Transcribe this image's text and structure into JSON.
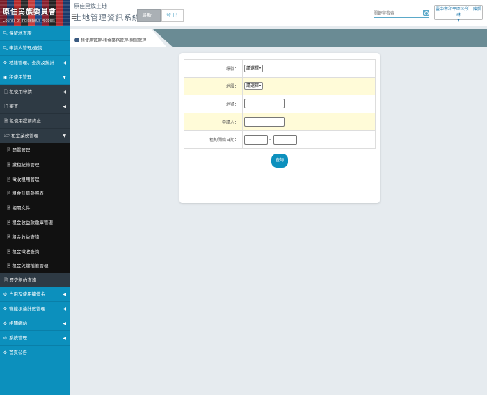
{
  "header": {
    "logo_text": "原住民族委員會",
    "logo_sub": "Council of Indigenous Peoples",
    "title_line1": "原住民族土地",
    "title_line2": "土地管理資訊系統",
    "notice_label": "最新公告",
    "logout_label": "登 出",
    "search_placeholder": "關鍵字檢索",
    "user_line1": "臺中市和平區公所：陳凱琳",
    "user_line2": "▾"
  },
  "sidebar": {
    "items": [
      {
        "label": "保留地查詢",
        "icon": "search-icon"
      },
      {
        "label": "申請人管理/查詢",
        "icon": "search-icon"
      },
      {
        "label": "地籍管理、查詢及統計",
        "icon": "gear-icon",
        "arrow": "◀"
      },
      {
        "label": "租使用管理",
        "icon": "globe-icon",
        "arrow": "▼"
      }
    ],
    "sub": [
      {
        "label": "租使用申請",
        "icon": "file-icon",
        "arrow": "◀"
      },
      {
        "label": "審查",
        "icon": "file-icon",
        "arrow": "◀"
      },
      {
        "label": "租使用提前終止",
        "icon": "doc-icon"
      },
      {
        "label": "租金業務管理",
        "icon": "folder-icon",
        "arrow": "▼"
      }
    ],
    "sub2": [
      "開單管理",
      "繳租紀錄管理",
      "徵收租用管理",
      "租金計算參照表",
      "相關文件",
      "租金收益款繳庫管理",
      "租金收益查詢",
      "租金徵收查詢",
      "租金欠繳稽催管理"
    ],
    "history": "歷史租約查詢",
    "bottom": [
      {
        "label": "占用及使用補償金",
        "icon": "gear-icon",
        "arrow": "◀"
      },
      {
        "label": "機能項補計數管理",
        "icon": "gear-icon",
        "arrow": "◀"
      },
      {
        "label": "相關網站",
        "icon": "gear-icon",
        "arrow": "◀"
      },
      {
        "label": "系統管理",
        "icon": "gear-icon",
        "arrow": "◀"
      },
      {
        "label": "首頁公告",
        "icon": "gear-icon"
      }
    ]
  },
  "breadcrumb": "租使用管理-租金業務管理-開單管理",
  "form": {
    "rows": [
      {
        "label": "標號：",
        "type": "select",
        "value": "請選擇"
      },
      {
        "label": "地段：",
        "type": "select",
        "value": "請選擇"
      },
      {
        "label": "地號：",
        "type": "text",
        "value": ""
      },
      {
        "label": "申請人：",
        "type": "text",
        "value": ""
      },
      {
        "label": "租約開始日期：",
        "type": "range",
        "value": "-"
      }
    ],
    "query_label": "查詢"
  },
  "colors": {
    "sidebar": "#0c90bd",
    "submenu": "#2e3a44",
    "submenu2": "#111111",
    "highlight_row": "#fffbd8"
  }
}
